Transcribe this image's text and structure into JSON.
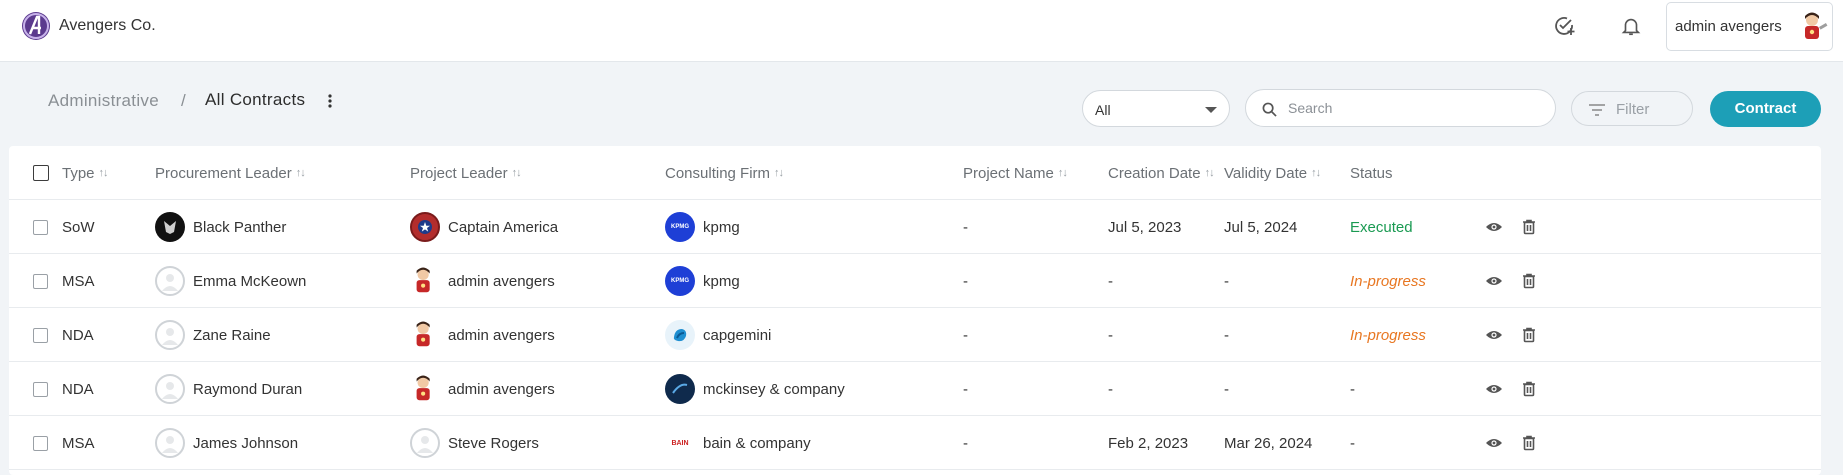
{
  "app": {
    "brand": "Avengers Co."
  },
  "topbar": {
    "user_name": "admin avengers"
  },
  "breadcrumb": {
    "parent": "Administrative",
    "separator": "/",
    "current": "All Contracts"
  },
  "toolbar": {
    "type_select_value": "All",
    "search_placeholder": "Search",
    "filter_label": "Filter",
    "contract_button_label": "Contract"
  },
  "table": {
    "headers": {
      "type": "Type",
      "procurement_leader": "Procurement Leader",
      "project_leader": "Project Leader",
      "consulting_firm": "Consulting Firm",
      "project_name": "Project Name",
      "creation_date": "Creation Date",
      "validity_date": "Validity Date",
      "status": "Status"
    },
    "sort_glyph": "↑↓",
    "rows": [
      {
        "type": "SoW",
        "procurement_leader": "Black Panther",
        "project_leader": "Captain America",
        "consulting_firm": "kpmg",
        "project_name": "-",
        "creation_date": "Jul 5, 2023",
        "validity_date": "Jul 5, 2024",
        "status": "Executed"
      },
      {
        "type": "MSA",
        "procurement_leader": "Emma McKeown",
        "project_leader": "admin avengers",
        "consulting_firm": "kpmg",
        "project_name": "-",
        "creation_date": "-",
        "validity_date": "-",
        "status": "In-progress"
      },
      {
        "type": "NDA",
        "procurement_leader": "Zane Raine",
        "project_leader": "admin avengers",
        "consulting_firm": "capgemini",
        "project_name": "-",
        "creation_date": "-",
        "validity_date": "-",
        "status": "In-progress"
      },
      {
        "type": "NDA",
        "procurement_leader": "Raymond Duran",
        "project_leader": "admin avengers",
        "consulting_firm": "mckinsey & company",
        "project_name": "-",
        "creation_date": "-",
        "validity_date": "-",
        "status": "-"
      },
      {
        "type": "MSA",
        "procurement_leader": "James Johnson",
        "project_leader": "Steve Rogers",
        "consulting_firm": "bain & company",
        "project_name": "-",
        "creation_date": "Feb 2, 2023",
        "validity_date": "Mar 26, 2024",
        "status": "-"
      }
    ]
  },
  "logos": {
    "kpmg": "KPMG",
    "bain": "BAIN"
  },
  "colors": {
    "accent": "#1d9fb7",
    "executed": "#1a9a52",
    "in_progress": "#e87722"
  }
}
